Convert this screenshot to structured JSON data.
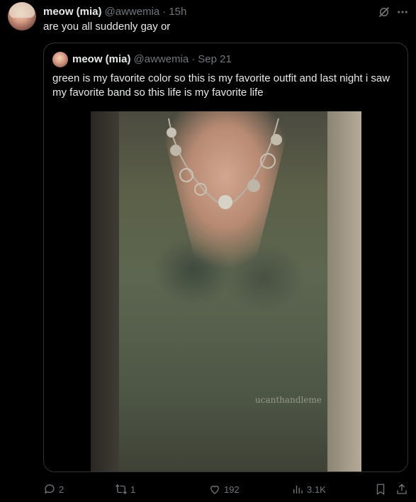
{
  "tweet": {
    "author": {
      "display_name": "meow (mia)",
      "handle": "@awwemia",
      "separator": "·",
      "time": "15h"
    },
    "text": "are you all suddenly gay or",
    "icons": {
      "grok": "grok-icon",
      "more": "more-icon"
    },
    "quote": {
      "author": {
        "display_name": "meow (mia)",
        "handle": "@awwemia",
        "separator": "·",
        "date": "Sep 21"
      },
      "text": "green is my favorite color so this is my favorite outfit and last night i saw my favorite band so this life is my favorite life",
      "media": {
        "watermark": "ucanthandleme"
      }
    },
    "actions": {
      "replies": "2",
      "reposts": "1",
      "likes": "192",
      "views": "3.1K"
    }
  },
  "colors": {
    "background": "#000000",
    "primary_text": "#e7e9ea",
    "secondary_text": "#71767b",
    "border": "#2f3336"
  }
}
